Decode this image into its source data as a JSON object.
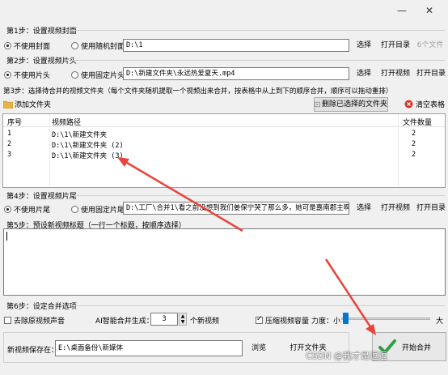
{
  "window": {
    "min_glyph": "—",
    "close_glyph": "✕"
  },
  "step1": {
    "title": "第1步：设置视频封面",
    "opt_no": "不使用封面",
    "opt_random": "使用随机封面",
    "path": "D:\\1",
    "select_btn": "选择",
    "open_dir_btn": "打开目录",
    "count_label": "6个文件"
  },
  "step2": {
    "title": "第2步：设置视频片头",
    "opt_no": "不使用片头",
    "opt_fixed": "使用固定片头",
    "path": "D:\\新建文件夹\\永远热爱夏天.mp4",
    "select_btn": "选择",
    "open_video_btn": "打开视频",
    "open_dir_btn": "打开目录"
  },
  "step3": {
    "title": "第3步：选择待合并的视频文件夹（每个文件夹随机提取一个视频出来合并，按表格中从上到下的顺序合并，顺序可以拖动重排）",
    "add_folder_btn": "添加文件夹",
    "delete_btn": "删除已选择的文件夹",
    "clear_btn": "清空表格",
    "columns": [
      "序号",
      "视频路径",
      "文件数量"
    ],
    "rows": [
      {
        "index": "1",
        "path": "D:\\1\\新建文件夹",
        "count": "2"
      },
      {
        "index": "2",
        "path": "D:\\1\\新建文件夹 (2)",
        "count": "2"
      },
      {
        "index": "3",
        "path": "D:\\1\\新建文件夹 (3)",
        "count": "2"
      }
    ]
  },
  "step4": {
    "title": "第4步：设置视频片尾",
    "opt_no": "不使用片尾",
    "opt_fixed": "使用固定片尾",
    "path": "D:\\工厂\\合并1\\看之前没想到我们姜保宁哭了那么多，她可是嘉南郡主啊.mp4",
    "select_btn": "选择",
    "open_video_btn": "打开视频",
    "open_dir_btn": "打开目录"
  },
  "step5": {
    "title": "第5步：预设新视频标题（一行一个标题，按顺序选择）",
    "content": ""
  },
  "step6": {
    "title": "第6步：设定合并选项",
    "remove_audio_label": "去除原视频声音",
    "ai_label": "AI智能合并生成：",
    "ai_value": "3",
    "ai_suffix": "个新视频",
    "compress_label": "压缩视频容量",
    "strength_label": "力度：小",
    "strength_max": "大",
    "save_label": "新视频保存在：",
    "save_path": "E:\\桌面备份\\新媒体",
    "browse_btn": "浏览",
    "open_folder_btn": "打开文件夹",
    "start_btn": "开始合并"
  },
  "watermark": "CSDN @我才是逗逗",
  "colors": {
    "accent_arrow": "#e8443a",
    "start_check": "#2ea043",
    "clear_icon": "#d9342b"
  }
}
